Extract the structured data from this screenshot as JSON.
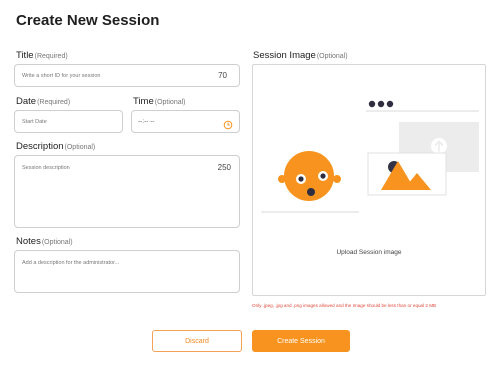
{
  "page": {
    "title": "Create New Session"
  },
  "form": {
    "title": {
      "label": "Title",
      "qualifier": "(Required)",
      "placeholder": "Write a short ID for your session",
      "counter": "70"
    },
    "date": {
      "label": "Date",
      "qualifier": "(Required)",
      "placeholder": "Start Date"
    },
    "time": {
      "label": "Time",
      "qualifier": "(Optional)",
      "value": "--:-- --"
    },
    "description": {
      "label": "Description",
      "qualifier": "(Optional)",
      "placeholder": "Session description",
      "counter": "250"
    },
    "notes": {
      "label": "Notes",
      "qualifier": "(Optional)",
      "placeholder": "Add a description for the administrator..."
    }
  },
  "image": {
    "label": "Session Image",
    "qualifier": "(Optional)",
    "upload_label": "Upload Session image",
    "note": "Only .jpeg, .jpg and .png images allowed and the Image should be less than or equal 2 MB"
  },
  "actions": {
    "discard": "Discard",
    "create": "Create Session"
  },
  "colors": {
    "accent": "#f7931e",
    "error": "#e34a3c"
  },
  "icons": {
    "time_field": "clock-icon",
    "illustration": "upload-illustration"
  }
}
